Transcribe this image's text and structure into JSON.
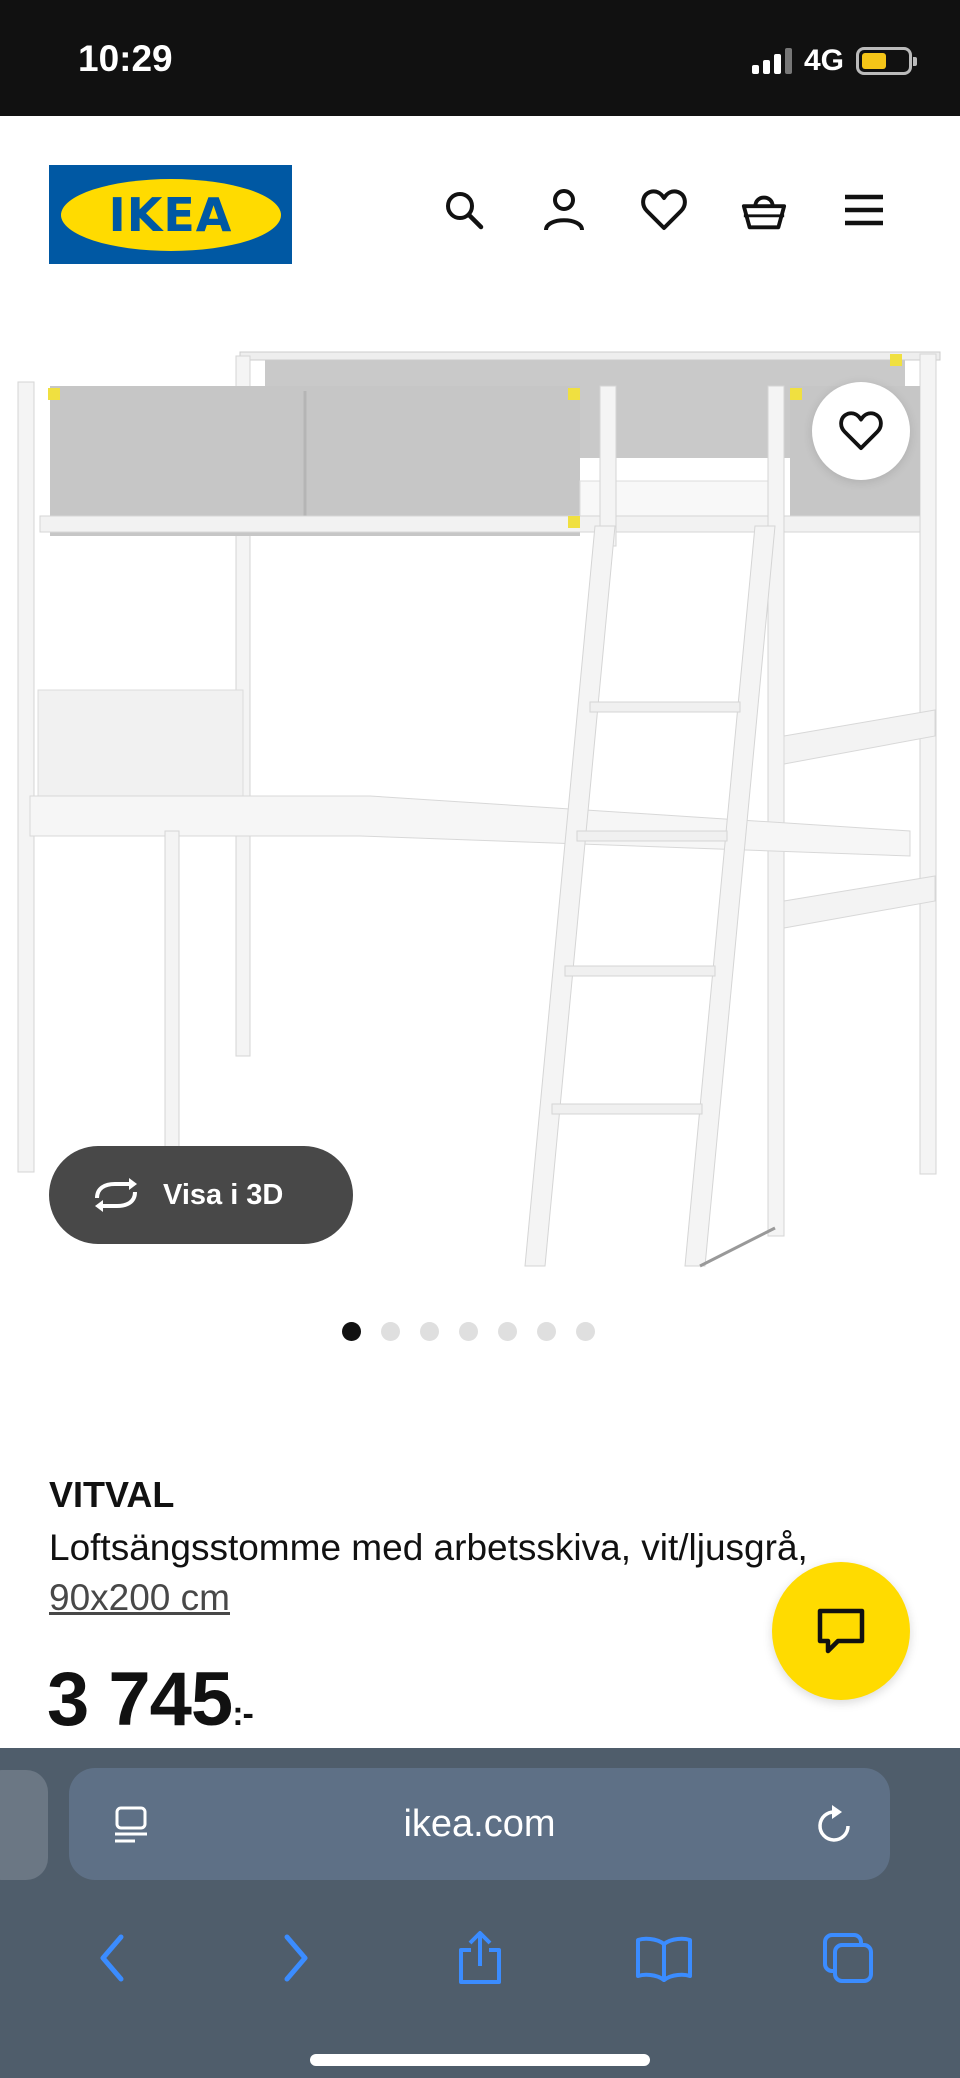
{
  "status_bar": {
    "time": "10:29",
    "network": "4G"
  },
  "header": {
    "logo_text": "IKEA",
    "icons": [
      "search-icon",
      "user-icon",
      "heart-icon",
      "basket-icon",
      "menu-icon"
    ]
  },
  "gallery": {
    "view_3d_label": "Visa i 3D",
    "image_count": 7,
    "active_index": 0
  },
  "product": {
    "brand": "VITVAL",
    "description": "Loftsängsstomme med arbetsskiva, vit/ljusgrå,",
    "size": "90x200 cm",
    "price_main": "3 745",
    "price_suffix": ":-"
  },
  "browser": {
    "url": "ikea.com"
  },
  "colors": {
    "ikea_blue": "#0058a3",
    "ikea_yellow": "#ffdb00",
    "browser_bar": "#4f5d6b",
    "safari_blue": "#3b8cff"
  }
}
